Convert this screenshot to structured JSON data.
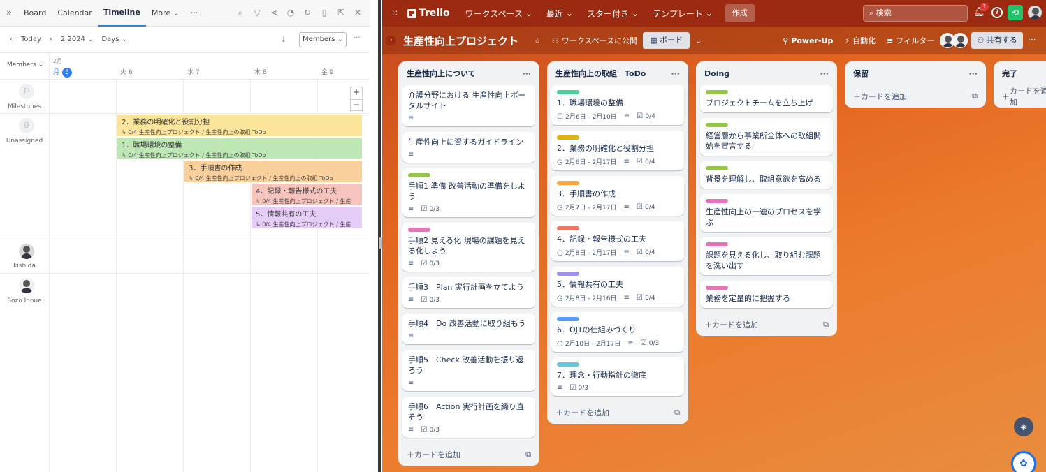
{
  "left": {
    "tabs": [
      "Board",
      "Calendar",
      "Timeline",
      "More"
    ],
    "active_tab": "Timeline",
    "toolbar": {
      "today": "Today",
      "period": "2 2024",
      "scale": "Days",
      "members_btn": "Members"
    },
    "header": {
      "members_col": "Members",
      "month": "2月",
      "days": [
        "月",
        "火 6",
        "水 7",
        "木 8",
        "金 9"
      ],
      "today_num": "5"
    },
    "rows": {
      "milestones": "Milestones",
      "unassigned": "Unassigned",
      "user1": "kishida",
      "user2": "Sozo Inoue"
    },
    "bars": [
      {
        "title": "2．業務の明確化と役割分担",
        "sub": "↳ 0/4  生産性向上プロジェクト / 生産性向上の取組    ToDo",
        "color": "#fbe59a"
      },
      {
        "title": "1．職場環境の整備",
        "sub": "↳ 0/4  生産性向上プロジェクト / 生産性向上の取組    ToDo",
        "color": "#bfe7b5"
      },
      {
        "title": "3．手順書の作成",
        "sub": "↳ 0/4  生産性向上プロジェクト / 生産性向上の取組    ToDo",
        "color": "#f9cf9b"
      },
      {
        "title": "4．記録・報告様式の工夫",
        "sub": "↳ 0/4  生産性向上プロジェクト / 生産",
        "color": "#f7c3bd"
      },
      {
        "title": "5．情報共有の工夫",
        "sub": "↳ 0/4  生産性向上プロジェクト / 生産",
        "color": "#e6cdf7"
      }
    ]
  },
  "trello": {
    "nav": {
      "workspaces": "ワークスペース",
      "recent": "最近",
      "starred": "スター付き",
      "templates": "テンプレート",
      "create": "作成",
      "search": "検索",
      "notif_count": "1",
      "brand": "Trello"
    },
    "board": {
      "title": "生産性向上プロジェクト",
      "visibility": "ワークスペースに公開",
      "view": "ボード",
      "powerup": "Power-Up",
      "automation": "自動化",
      "filter": "フィルター",
      "share": "共有する"
    },
    "add_card": "カードを追加",
    "lists": [
      {
        "name": "生産性向上について",
        "cards": [
          {
            "text": "介護分野における 生産性向上ポータルサイト",
            "label": "",
            "date": "",
            "check": ""
          },
          {
            "text": "生産性向上に資するガイドライン",
            "label": "",
            "date": "",
            "check": ""
          },
          {
            "text": "手順1 準備 改善活動の準備をしよう",
            "label": "#94c748",
            "date": "",
            "check": "0/3"
          },
          {
            "text": "手順2 見える化 現場の課題を見える化しよう",
            "label": "#e774bb",
            "date": "",
            "check": "0/3"
          },
          {
            "text": "手順3　Plan 実行計画を立てよう",
            "label": "",
            "date": "",
            "check": "0/3"
          },
          {
            "text": "手順4　Do 改善活動に取り組もう",
            "label": "",
            "date": "",
            "check": ""
          },
          {
            "text": "手順5　Check 改善活動を振り返ろう",
            "label": "",
            "date": "",
            "check": ""
          },
          {
            "text": "手順6　Action 実行計画を繰り直そう",
            "label": "",
            "date": "",
            "check": "0/3"
          }
        ]
      },
      {
        "name": "生産性向上の取組　ToDo",
        "cards": [
          {
            "text": "1．職場環境の整備",
            "label": "#4bce97",
            "date": "2月6日 - 2月10日",
            "check": "0/4"
          },
          {
            "text": "2．業務の明確化と役割分担",
            "label": "#e2b203",
            "date": "2月6日 - 2月17日",
            "check": "0/4"
          },
          {
            "text": "3．手順書の作成",
            "label": "#faa53d",
            "date": "2月7日 - 2月17日",
            "check": "0/4"
          },
          {
            "text": "4．記録・報告様式の工夫",
            "label": "#f87462",
            "date": "2月8日 - 2月17日",
            "check": "0/4"
          },
          {
            "text": "5．情報共有の工夫",
            "label": "#9f8fef",
            "date": "2月8日 - 2月16日",
            "check": "0/4"
          },
          {
            "text": "6．OJTの仕組みづくり",
            "label": "#579dff",
            "date": "2月10日 - 2月17日",
            "check": "0/3"
          },
          {
            "text": "7．理念・行動指針の徹底",
            "label": "#6cc3e0",
            "date": "",
            "check": "0/3"
          }
        ]
      },
      {
        "name": "Doing",
        "cards": [
          {
            "text": "プロジェクトチームを立ち上げ",
            "label": "#94c748",
            "date": "",
            "check": ""
          },
          {
            "text": "経営層から事業所全体への取組開始を宣言する",
            "label": "#94c748",
            "date": "",
            "check": ""
          },
          {
            "text": "背景を理解し、取組意欲を高める",
            "label": "#94c748",
            "date": "",
            "check": ""
          },
          {
            "text": "生産性向上の一連のプロセスを学ぶ",
            "label": "#e774bb",
            "date": "",
            "check": ""
          },
          {
            "text": "課題を見える化し、取り組む課題を洗い出す",
            "label": "#e774bb",
            "date": "",
            "check": ""
          },
          {
            "text": "業務を定量的に把握する",
            "label": "#e774bb",
            "date": "",
            "check": ""
          }
        ]
      },
      {
        "name": "保留",
        "cards": []
      },
      {
        "name": "完了",
        "cards": []
      }
    ]
  }
}
